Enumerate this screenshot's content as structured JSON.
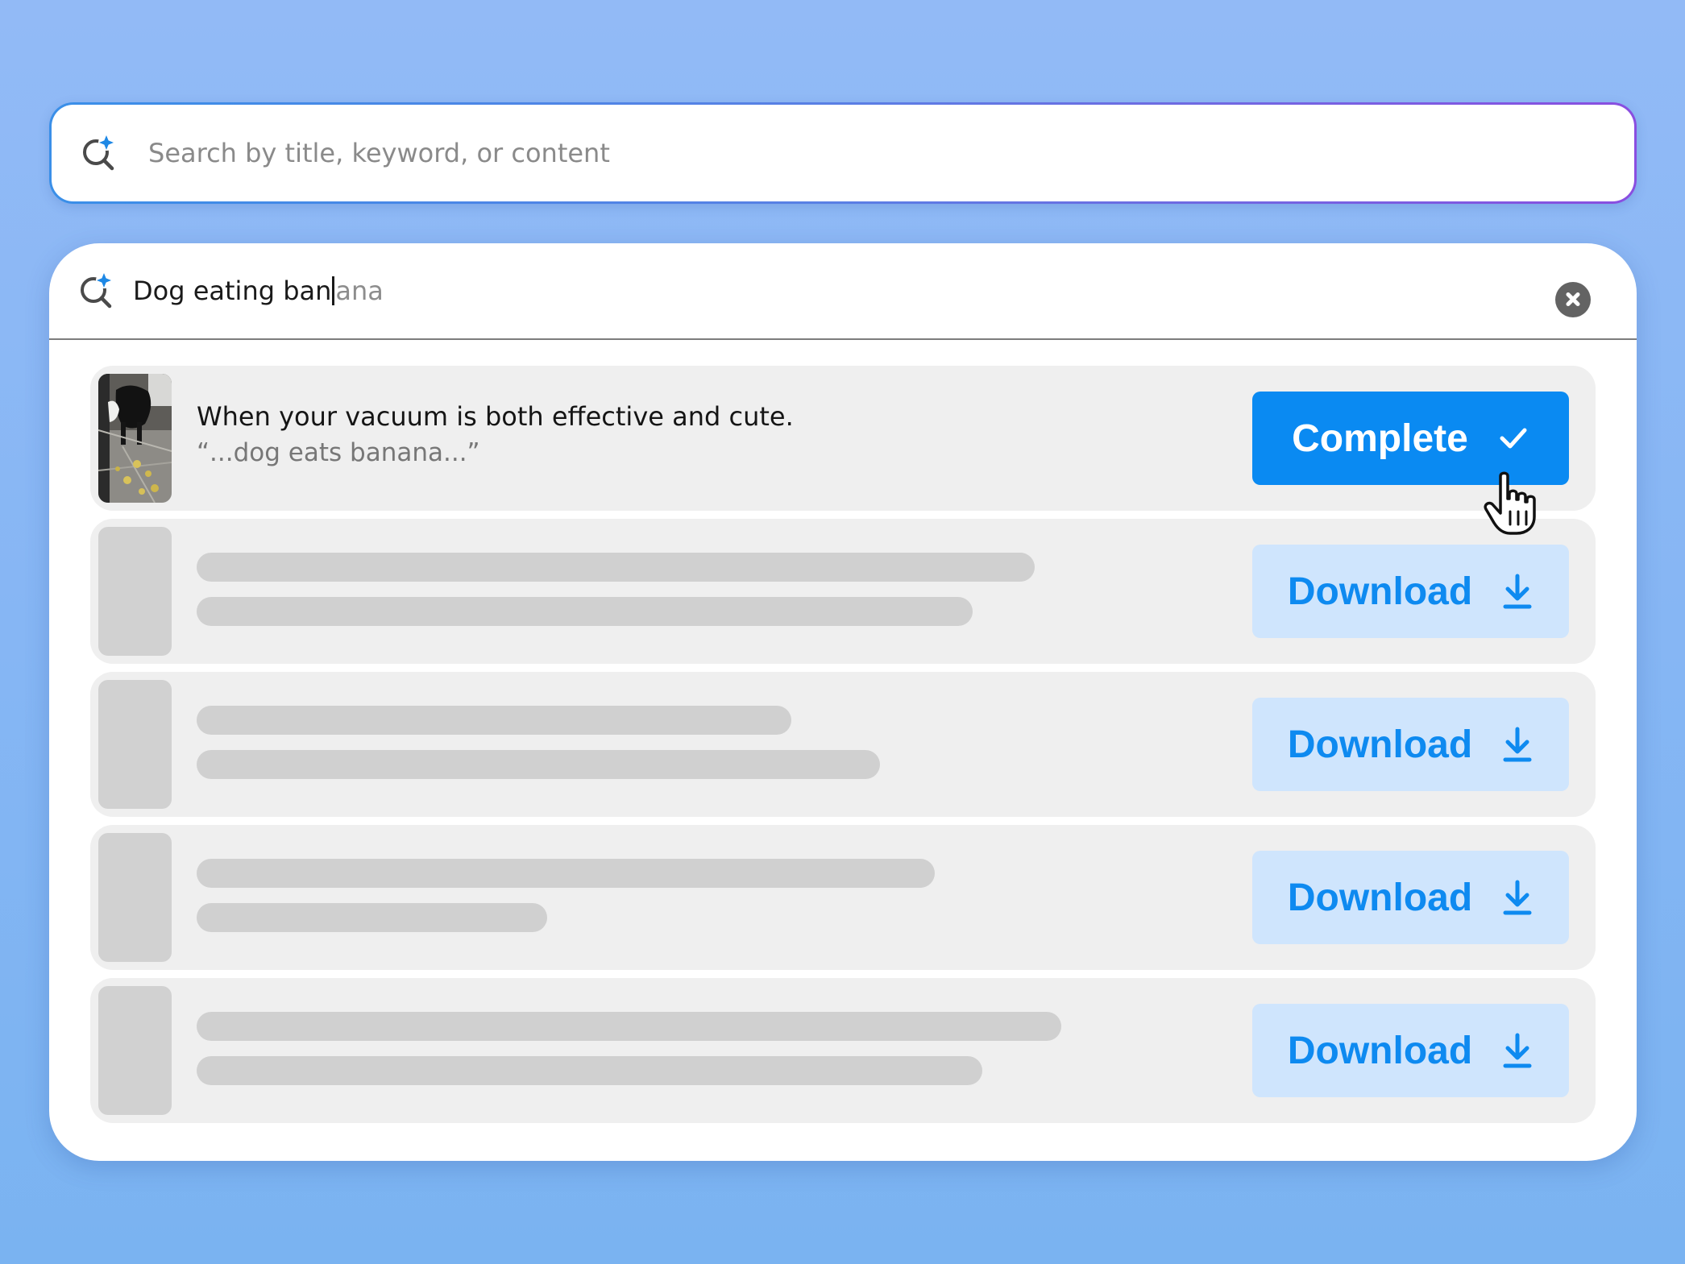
{
  "search": {
    "placeholder": "Search by title, keyword, or content",
    "icon": "ai-sparkle-search-icon"
  },
  "panel": {
    "query_typed": "Dog eating ban",
    "query_suggestion": "ana",
    "clear_icon": "close-circle-icon"
  },
  "results": [
    {
      "title": "When your vacuum is both effective and cute.",
      "snippet": "“...dog eats banana...”",
      "button_label": "Complete",
      "button_icon": "check-icon",
      "state": "complete"
    },
    {
      "button_label": "Download",
      "button_icon": "download-icon",
      "state": "loading"
    },
    {
      "button_label": "Download",
      "button_icon": "download-icon",
      "state": "loading"
    },
    {
      "button_label": "Download",
      "button_icon": "download-icon",
      "state": "loading"
    },
    {
      "button_label": "Download",
      "button_icon": "download-icon",
      "state": "loading"
    }
  ],
  "colors": {
    "background": "#86b6f4",
    "primary_button": "#0a8af2",
    "secondary_button": "#cfe5fd",
    "secondary_button_text": "#0e8af0",
    "skeleton": "#d0d0d0",
    "row_background": "#efefef"
  }
}
